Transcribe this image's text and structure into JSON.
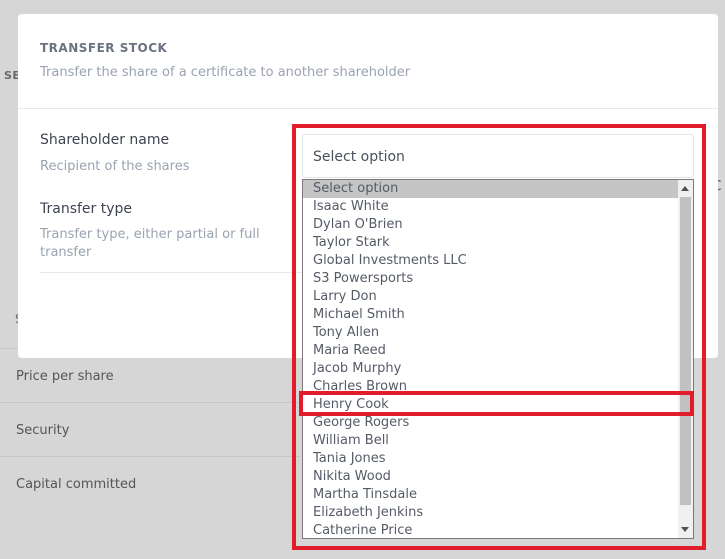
{
  "background": {
    "section_label": "SE",
    "rows": [
      "Price per share",
      "Security",
      "Capital committed"
    ],
    "edge_marks": {
      "top_right": "s",
      "right_c": "c",
      "left_s": "S"
    }
  },
  "modal": {
    "title": "TRANSFER STOCK",
    "subtitle": "Transfer the share of a certificate to another shareholder",
    "fields": [
      {
        "label": "Shareholder name",
        "help": "Recipient of the shares"
      },
      {
        "label": "Transfer type",
        "help": "Transfer type, either partial or full transfer"
      }
    ],
    "select": {
      "value": "Select option"
    }
  },
  "dropdown": {
    "options": [
      "Select option",
      "Isaac White",
      "Dylan O'Brien",
      "Taylor Stark",
      "Global Investments LLC",
      "S3 Powersports",
      "Larry Don",
      "Michael Smith",
      "Tony Allen",
      "Maria Reed",
      "Jacob Murphy",
      "Charles Brown",
      "Henry Cook",
      "George Rogers",
      "William Bell",
      "Tania Jones",
      "Nikita Wood",
      "Martha Tinsdale",
      "Elizabeth Jenkins",
      "Catherine Price"
    ],
    "highlighted": "Select option",
    "annotated": "Henry Cook"
  },
  "colors": {
    "annotation": "#e21d2b",
    "overlay": "#d6d6d6",
    "highlight": "#c5c5c5"
  }
}
